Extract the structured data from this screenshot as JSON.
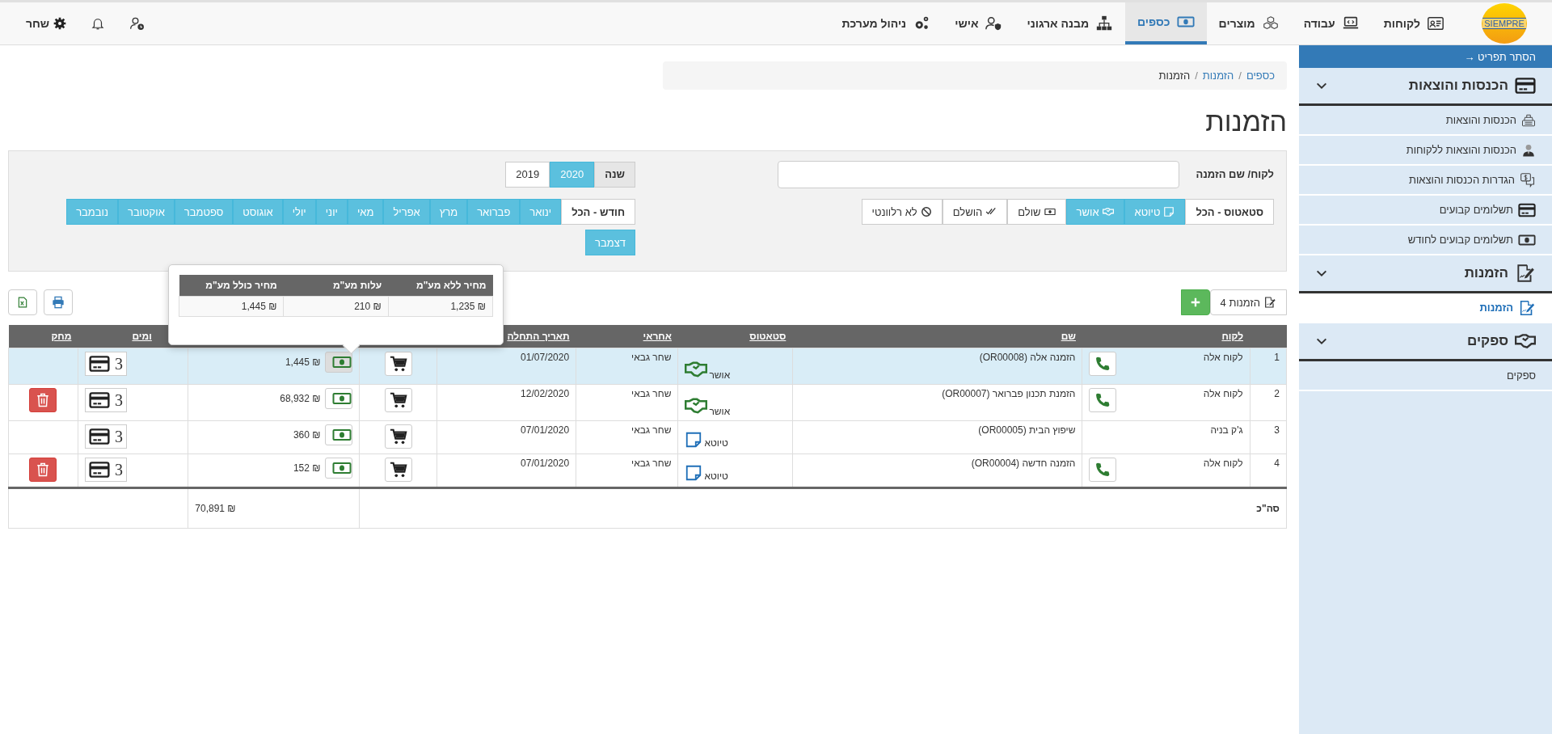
{
  "nav": {
    "logo": "SIEMPRE",
    "items": [
      {
        "label": "לקוחות",
        "selected": false
      },
      {
        "label": "עבודה",
        "selected": false
      },
      {
        "label": "מוצרים",
        "selected": false
      },
      {
        "label": "כספים",
        "selected": true
      },
      {
        "label": "מבנה ארגוני",
        "selected": false
      },
      {
        "label": "אישי",
        "selected": false
      },
      {
        "label": "ניהול מערכת",
        "selected": false
      }
    ],
    "user": "שחר"
  },
  "sidebar": {
    "hide_label": "הסתר תפריט →",
    "sections": [
      {
        "title": "הכנסות והוצאות",
        "expanded": true,
        "children": [
          {
            "label": "הכנסות והוצאות",
            "selected": false
          },
          {
            "label": "הכנסות והוצאות ללקוחות",
            "selected": false
          },
          {
            "label": "הגדרות הכנסות והוצאות",
            "selected": false
          },
          {
            "label": "תשלומים קבועים",
            "selected": false
          },
          {
            "label": "תשלומים קבועים לחודש",
            "selected": false
          }
        ]
      },
      {
        "title": "הזמנות",
        "expanded": true,
        "children": [
          {
            "label": "הזמנות",
            "selected": true
          }
        ]
      },
      {
        "title": "ספקים",
        "expanded": true,
        "children": [
          {
            "label": "ספקים",
            "selected": false
          }
        ]
      }
    ]
  },
  "breadcrumb_separator": "/",
  "breadcrumbs": [
    {
      "label": "כספים",
      "current": false
    },
    {
      "label": "הזמנות",
      "current": false
    },
    {
      "label": "הזמנות",
      "current": true
    }
  ],
  "title": "הזמנות",
  "filters": {
    "search": {
      "label": "לקוח/ שם הזמנה"
    },
    "year": {
      "label": "שנה",
      "options": [
        {
          "label": "2020",
          "selected": true
        },
        {
          "label": "2019",
          "selected": false
        }
      ]
    },
    "status": {
      "label": "סטאטוס - הכל",
      "options": [
        {
          "label": "טיוטא",
          "kind": "draft",
          "selected": true
        },
        {
          "label": "אושר",
          "kind": "approved",
          "selected": true
        },
        {
          "label": "שולם",
          "kind": "paid",
          "selected": false
        },
        {
          "label": "הושלם",
          "kind": "done",
          "selected": false
        },
        {
          "label": "לא רלוונטי",
          "kind": "irrelevant",
          "selected": false
        }
      ]
    },
    "month": {
      "label": "חודש - הכל",
      "options": [
        {
          "label": "ינואר",
          "selected": true
        },
        {
          "label": "פברואר",
          "selected": true
        },
        {
          "label": "מרץ",
          "selected": true
        },
        {
          "label": "אפריל",
          "selected": true
        },
        {
          "label": "מאי",
          "selected": true
        },
        {
          "label": "יוני",
          "selected": true
        },
        {
          "label": "יולי",
          "selected": true
        },
        {
          "label": "אוגוסט",
          "selected": true
        },
        {
          "label": "ספטמבר",
          "selected": true
        },
        {
          "label": "אוקטובר",
          "selected": true
        },
        {
          "label": "נובמבר",
          "selected": true
        },
        {
          "label": "דצמבר",
          "selected": true
        }
      ]
    }
  },
  "toolbar": {
    "orders_count": "הזמנות 4"
  },
  "tooltip": {
    "columns": [
      "מחיר ללא מע\"מ",
      "עלות מע\"מ",
      "מחיר כולל מע\"מ"
    ],
    "values": [
      "1,235 ₪",
      "210 ₪",
      "1,445 ₪"
    ]
  },
  "table": {
    "headers": {
      "client": "לקוח",
      "name": "שם",
      "status": "סטאטוס",
      "responsible": "אחראי",
      "start_date": "תאריך התחלה",
      "payments": "ומים",
      "delete": "מחק"
    },
    "rows": [
      {
        "index": "1",
        "client": "לקוח אלה",
        "phone": true,
        "name": "הזמנה אלה (OR00008)",
        "status": {
          "kind": "approved",
          "label": "אושר"
        },
        "responsible": "שחר גבאי",
        "start_date": "01/07/2020",
        "price": "1,445 ₪",
        "price_open": true,
        "payments": "3",
        "deletable": false,
        "selected": true
      },
      {
        "index": "2",
        "client": "לקוח אלה",
        "phone": true,
        "name": "הזמנת תכנון פברואר (OR00007)",
        "status": {
          "kind": "approved",
          "label": "אושר"
        },
        "responsible": "שחר גבאי",
        "start_date": "12/02/2020",
        "price": "68,932 ₪",
        "price_open": false,
        "payments": "3",
        "deletable": true,
        "selected": false
      },
      {
        "index": "3",
        "client": "ג'ק בניה",
        "phone": false,
        "name": "שיפוץ הבית (OR00005)",
        "status": {
          "kind": "draft",
          "label": "טיוטא"
        },
        "responsible": "שחר גבאי",
        "start_date": "07/01/2020",
        "price": "360 ₪",
        "price_open": false,
        "payments": "3",
        "deletable": false,
        "selected": false
      },
      {
        "index": "4",
        "client": "לקוח אלה",
        "phone": true,
        "name": "הזמנה חדשה (OR00004)",
        "status": {
          "kind": "draft",
          "label": "טיוטא"
        },
        "responsible": "שחר גבאי",
        "start_date": "07/01/2020",
        "price": "152 ₪",
        "price_open": false,
        "payments": "3",
        "deletable": true,
        "selected": false
      }
    ],
    "total": {
      "label": "סה\"כ",
      "price": "70,891 ₪"
    }
  }
}
